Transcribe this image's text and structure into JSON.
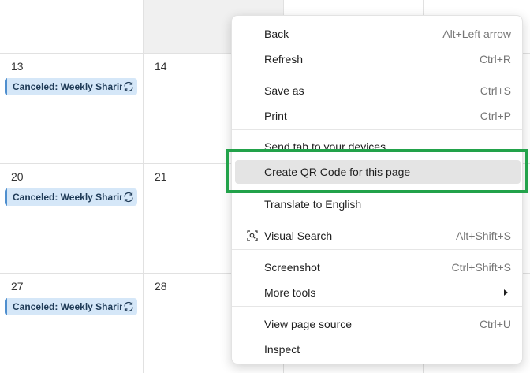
{
  "calendar": {
    "days": [
      {
        "num": "13",
        "event": "Canceled: Weekly Sharing"
      },
      {
        "num": "14",
        "event": ""
      },
      {
        "num": "20",
        "event": "Canceled: Weekly Sharing"
      },
      {
        "num": "21",
        "event": ""
      },
      {
        "num": "27",
        "event": "Canceled: Weekly Sharing"
      },
      {
        "num": "28",
        "event": ""
      }
    ],
    "event_color": "#d5e7f8"
  },
  "menu": {
    "back": {
      "label": "Back",
      "shortcut": "Alt+Left arrow"
    },
    "refresh": {
      "label": "Refresh",
      "shortcut": "Ctrl+R"
    },
    "save_as": {
      "label": "Save as",
      "shortcut": "Ctrl+S"
    },
    "print": {
      "label": "Print",
      "shortcut": "Ctrl+P"
    },
    "send_tab": {
      "label": "Send tab to your devices"
    },
    "create_qr": {
      "label": "Create QR Code for this page"
    },
    "translate": {
      "label": "Translate to English"
    },
    "visual_search": {
      "label": "Visual Search",
      "shortcut": "Alt+Shift+S",
      "icon": "visual-search-icon"
    },
    "screenshot": {
      "label": "Screenshot",
      "shortcut": "Ctrl+Shift+S"
    },
    "more_tools": {
      "label": "More tools",
      "icon": "chevron-right-icon"
    },
    "view_source": {
      "label": "View page source",
      "shortcut": "Ctrl+U"
    },
    "inspect": {
      "label": "Inspect"
    },
    "highlight_color": "#22a24a"
  }
}
